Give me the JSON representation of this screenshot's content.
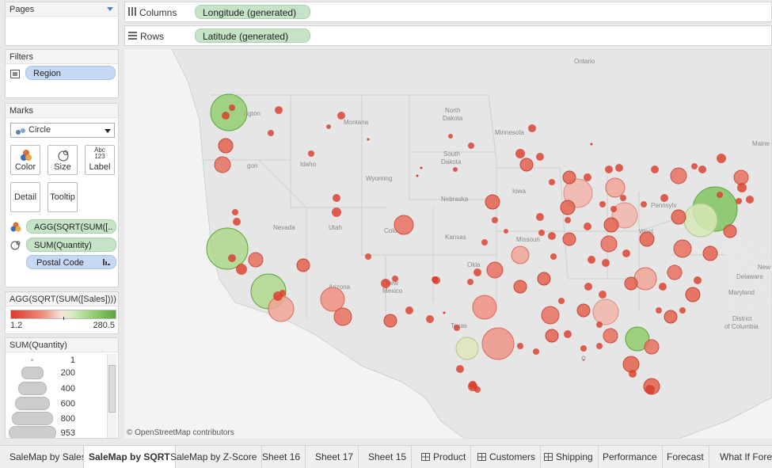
{
  "pages": {
    "title": "Pages"
  },
  "filters": {
    "title": "Filters",
    "items": [
      "Region"
    ]
  },
  "marks": {
    "title": "Marks",
    "mark_type": "Circle",
    "buttons": {
      "color": "Color",
      "size": "Size",
      "label": "Label",
      "detail": "Detail",
      "tooltip": "Tooltip"
    },
    "label_icon_text": [
      "Abc",
      "123"
    ],
    "fields": [
      "AGG(SQRT(SUM([..",
      "SUM(Quantity)",
      "Postal Code"
    ]
  },
  "color_legend": {
    "title": "AGG(SQRT(SUM([Sales])))",
    "min": "1.2",
    "max": "280.5"
  },
  "size_legend": {
    "title": "SUM(Quantity)",
    "values": [
      "1",
      "200",
      "400",
      "600",
      "800",
      "953"
    ]
  },
  "columns_shelf": {
    "label": "Columns",
    "pill": "Longitude (generated)"
  },
  "rows_shelf": {
    "label": "Rows",
    "pill": "Latitude (generated)"
  },
  "map": {
    "attribution": "© OpenStreetMap contributors",
    "labels": {
      "ontario": "Ontario",
      "washington": "ington",
      "montana": "Montana",
      "north_dakota_1": "North",
      "north_dakota_2": "Dakota",
      "minnesota": "Minnesota",
      "south_dakota_1": "South",
      "south_dakota_2": "Dakota",
      "oregon": "gon",
      "idaho": "Idaho",
      "wyoming": "Wyoming",
      "iowa": "Iowa",
      "nebraska": "Nebraska",
      "nevada": "Nevada",
      "utah": "Utah",
      "colorado": "Colo",
      "kansas": "Kansas",
      "missouri": "Missouri",
      "arizona": "Arizona",
      "new_mexico_1": "New",
      "new_mexico_2": "Mexico",
      "oklahoma": "Okla",
      "texas": "Texas",
      "west": "West",
      "pennsylvania": "Pennsylv",
      "delaware": "Delaware",
      "maryland": "Maryland",
      "district_1": "District",
      "district_2": "of Columbia",
      "maine": "Maine",
      "new": "New"
    }
  },
  "tabs": [
    "SaleMap by Sales",
    "SaleMap by SQRT",
    "SaleMap by Z-Score",
    "Sheet 16",
    "Sheet 17",
    "Sheet 15",
    "Product",
    "Customers",
    "Shipping",
    "Performance",
    "Forecast",
    "What If Forec"
  ],
  "active_tab": "SaleMap by SQRT",
  "colors": {
    "low": "#d93b28",
    "mid": "#f2e6e3",
    "high": "#5aa53c",
    "pill_blue": "#c7d9f2",
    "pill_green": "#c4e3c7"
  }
}
